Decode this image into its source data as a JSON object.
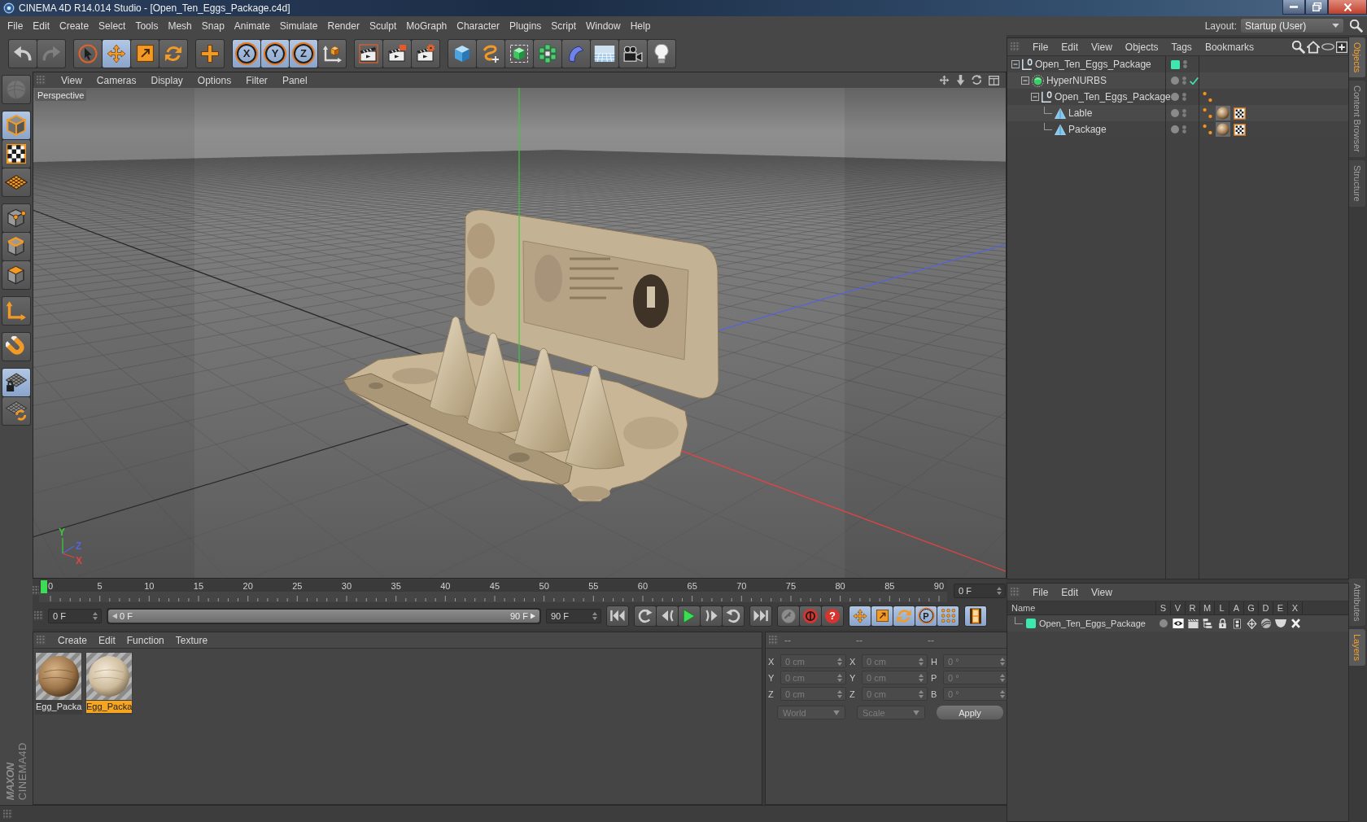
{
  "window": {
    "title": "CINEMA 4D R14.014 Studio - [Open_Ten_Eggs_Package.c4d]"
  },
  "menu_bar": {
    "items": [
      "File",
      "Edit",
      "Create",
      "Select",
      "Tools",
      "Mesh",
      "Snap",
      "Animate",
      "Simulate",
      "Render",
      "Sculpt",
      "MoGraph",
      "Character",
      "Plugins",
      "Script",
      "Window",
      "Help"
    ],
    "layout_label": "Layout:",
    "layout_value": "Startup (User)"
  },
  "toolbar": {
    "undo": {
      "disabled": false
    },
    "redo": {
      "disabled": true
    },
    "tools": [
      {
        "selected": false
      },
      {
        "selected": true
      },
      {
        "selected": false
      },
      {
        "selected": false
      }
    ],
    "axis_locks": [
      {
        "label": "X",
        "selected": true
      },
      {
        "label": "Y",
        "selected": true
      },
      {
        "label": "Z",
        "selected": true
      }
    ]
  },
  "left_toolbar": [
    {
      "selected": false,
      "disabled": true
    },
    {
      "selected": true,
      "disabled": false
    },
    {
      "selected": false,
      "disabled": false
    },
    {
      "selected": false,
      "disabled": false
    },
    {
      "selected": false,
      "disabled": false
    },
    {
      "selected": false,
      "disabled": false
    },
    {
      "selected": false,
      "disabled": false
    },
    {
      "selected": false,
      "disabled": false
    },
    {
      "selected": false,
      "disabled": false
    },
    {
      "selected": true,
      "disabled": false
    },
    {
      "selected": false,
      "disabled": false
    }
  ],
  "viewport": {
    "menu": [
      "View",
      "Cameras",
      "Display",
      "Options",
      "Filter",
      "Panel"
    ],
    "camera": "Perspective",
    "axes": [
      {
        "label": "Y",
        "color": "#3cc83c"
      },
      {
        "label": "Z",
        "color": "#5563e0"
      },
      {
        "label": "X",
        "color": "#e04444"
      }
    ]
  },
  "timeline": {
    "ticks": [
      "0",
      "5",
      "10",
      "15",
      "20",
      "25",
      "30",
      "35",
      "40",
      "45",
      "50",
      "55",
      "60",
      "65",
      "70",
      "75",
      "80",
      "85",
      "90"
    ],
    "level": 0,
    "frame": "0 F"
  },
  "playback": {
    "start": "0 F",
    "range": {
      "start": "0 F",
      "end": "90 F",
      "level": 1
    },
    "end": "90 F",
    "autokey": {
      "label": "?"
    },
    "keys": [
      {
        "selected": true
      },
      {
        "selected": true
      },
      {
        "selected": true
      },
      {
        "label": "P",
        "selected": true
      },
      {
        "selected": true
      }
    ],
    "timeline_button": {
      "selected": true
    }
  },
  "materials": {
    "menu": [
      "Create",
      "Edit",
      "Function",
      "Texture"
    ],
    "items": [
      {
        "name": "Egg_Packa",
        "selected": false
      },
      {
        "name": "Egg_Packa",
        "selected": true
      }
    ]
  },
  "coordinates": {
    "headers": [
      "--",
      "--",
      "--"
    ],
    "disabled": true,
    "rows": [
      [
        {
          "label": "X",
          "value": "0 cm"
        },
        {
          "label": "X",
          "value": "0 cm"
        },
        {
          "label": "H",
          "value": "0 °"
        }
      ],
      [
        {
          "label": "Y",
          "value": "0 cm"
        },
        {
          "label": "Y",
          "value": "0 cm"
        },
        {
          "label": "P",
          "value": "0 °"
        }
      ],
      [
        {
          "label": "Z",
          "value": "0 cm"
        },
        {
          "label": "Z",
          "value": "0 cm"
        },
        {
          "label": "B",
          "value": "0 °"
        }
      ]
    ],
    "dropdowns": [
      "World",
      "Scale"
    ],
    "apply": "Apply"
  },
  "object_manager": {
    "menu": [
      "File",
      "Edit",
      "View",
      "Objects",
      "Tags",
      "Bookmarks"
    ],
    "tree": [
      {
        "name": "Open_Ten_Eggs_Package",
        "kind": "null",
        "expanded": true,
        "color": "#3ee6b0",
        "children": [
          {
            "name": "HyperNURBS",
            "kind": "subdivision",
            "expanded": true,
            "enabled": true,
            "children": [
              {
                "name": "Open_Ten_Eggs_Package",
                "kind": "null",
                "expanded": true,
                "tags": [
                  {
                    "kind": "phong"
                  }
                ],
                "children": [
                  {
                    "name": "Lable",
                    "kind": "polygon",
                    "tags": [
                      {
                        "kind": "phong"
                      },
                      {
                        "kind": "material"
                      },
                      {
                        "kind": "uvw"
                      }
                    ]
                  },
                  {
                    "name": "Package",
                    "kind": "polygon",
                    "tags": [
                      {
                        "kind": "phong"
                      },
                      {
                        "kind": "material"
                      },
                      {
                        "kind": "uvw"
                      }
                    ]
                  }
                ]
              }
            ]
          }
        ]
      }
    ]
  },
  "side_tabs": {
    "top": [
      {
        "label": "Objects",
        "selected": true
      },
      {
        "label": "Content Browser",
        "selected": false
      },
      {
        "label": "Structure",
        "selected": false
      }
    ],
    "bottom": [
      {
        "label": "Attributes",
        "selected": false
      },
      {
        "label": "Layers",
        "selected": true
      }
    ]
  },
  "layer_manager": {
    "menu": [
      "File",
      "Edit",
      "View"
    ],
    "columns": [
      "Name",
      "S",
      "V",
      "R",
      "M",
      "L",
      "A",
      "G",
      "D",
      "E",
      "X"
    ],
    "rows": [
      {
        "name": "Open_Ten_Eggs_Package",
        "color": "#3ee6b0"
      }
    ]
  },
  "logo": {
    "brand": "MAXON",
    "product": "CINEMA4D"
  }
}
